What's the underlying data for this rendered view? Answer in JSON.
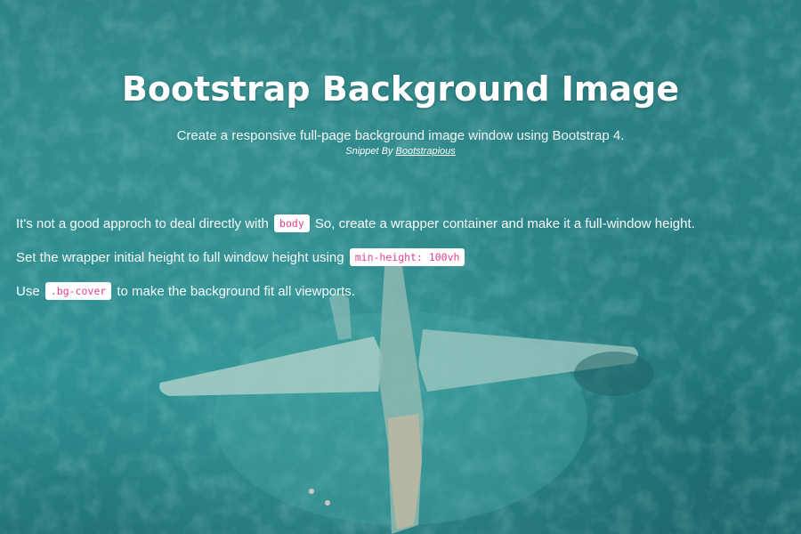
{
  "header": {
    "title": "Bootstrap Background Image",
    "lead": "Create a responsive full-page background image window using Bootstrap 4.",
    "credit_prefix": "Snippet By",
    "credit_link": "Bootstrapious"
  },
  "content": {
    "para1_before": "It's not a good approch to deal directly with",
    "para1_code": "body",
    "para1_after": "So, create a wrapper container and make it a full-window height.",
    "para2_before": "Set the wrapper initial height to full window height using",
    "para2_code": "min-height: 100vh",
    "para3_before": "Use",
    "para3_code": ".bg-cover",
    "para3_after": "to make the background fit all viewports."
  },
  "colors": {
    "water": "#2d8a8c",
    "code_text": "#e83e8c",
    "text": "#ffffff"
  },
  "background": {
    "subject": "aerial-sea-plane-wreck-image"
  }
}
